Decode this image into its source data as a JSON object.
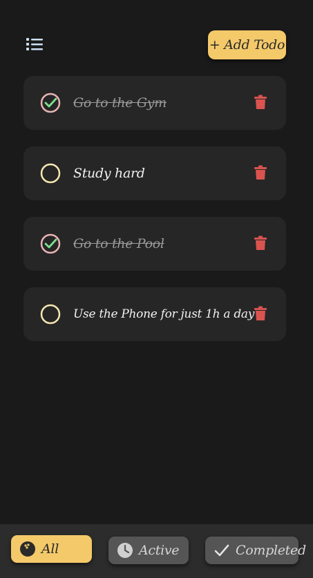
{
  "header": {
    "menu_icon": "list-icon",
    "add_button_label": "+ Add Todo"
  },
  "todos": [
    {
      "text": "Go to the Gym",
      "completed": true
    },
    {
      "text": "Study hard",
      "completed": false
    },
    {
      "text": "Go to the Pool",
      "completed": true
    },
    {
      "text": "Use the Phone for just 1h a day",
      "completed": false
    }
  ],
  "filters": [
    {
      "label": "All",
      "icon": "bowling-ball-icon",
      "selected": true
    },
    {
      "label": "Active",
      "icon": "clock-icon",
      "selected": false
    },
    {
      "label": "Completed",
      "icon": "check-icon",
      "selected": false
    }
  ],
  "colors": {
    "accent": "#f4c96a",
    "background": "#1a1a1a",
    "card": "#262626",
    "delete": "#d9534f",
    "check_ring_done": "#e8b4b4",
    "check_mark": "#7ee08f",
    "check_ring_open": "#f7e6b0"
  }
}
